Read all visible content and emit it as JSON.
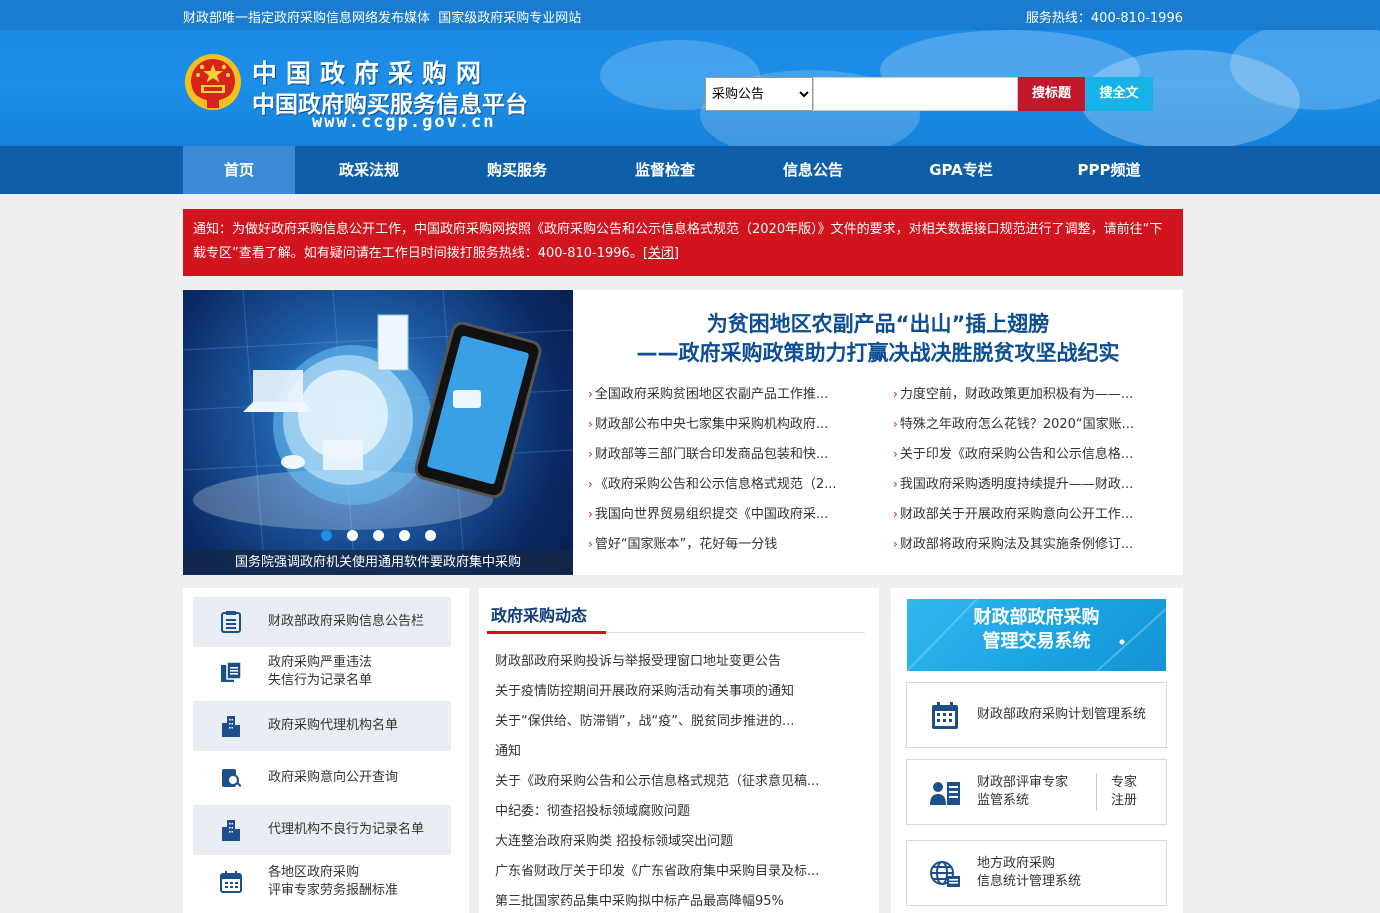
{
  "topbar": {
    "left": "财政部唯一指定政府采购信息网络发布媒体  国家级政府采购专业网站",
    "right": "服务热线：400-810-1996"
  },
  "logo": {
    "line1": "中国政府采购网",
    "line2": "中国政府购买服务信息平台",
    "url": "www.ccgp.gov.cn"
  },
  "search": {
    "select_value": "采购公告",
    "title_button": "搜标题",
    "fulltext_button": "搜全文"
  },
  "nav": [
    "首页",
    "政采法规",
    "购买服务",
    "监督检查",
    "信息公告",
    "GPA专栏",
    "PPP频道"
  ],
  "notice": {
    "text": "通知：为做好政府采购信息公开工作，中国政府采购网按照《政府采购公告和公示信息格式规范（2020年版）》文件的要求，对相关数据接口规范进行了调整，请前往“下载专区”查看了解。如有疑问请在工作日时间拨打服务热线：400-810-1996。",
    "close": "[关闭]"
  },
  "slider": {
    "caption": "国务院强调政府机关使用通用软件要政府集中采购"
  },
  "featured": {
    "title_line1": "为贫困地区农副产品“出山”插上翅膀",
    "title_line2": "——政府采购政策助力打赢决战决胜脱贫攻坚战纪实",
    "left_items": [
      "全国政府采购贫困地区农副产品工作推...",
      "财政部公布中央七家集中采购机构政府...",
      "财政部等三部门联合印发商品包装和快...",
      "《政府采购公告和公示信息格式规范（2...",
      "我国向世界贸易组织提交《中国政府采...",
      "管好“国家账本”，花好每一分钱"
    ],
    "right_items": [
      "力度空前，财政政策更加积极有为——...",
      "特殊之年政府怎么花钱？2020“国家账...",
      "关于印发《政府采购公告和公示信息格...",
      "我国政府采购透明度持续提升——财政...",
      "财政部关于开展政府采购意向公开工作...",
      "财政部将政府采购法及其实施条例修订..."
    ]
  },
  "left_links": [
    {
      "label": "财政部政府采购信息公告栏",
      "icon": "list-icon"
    },
    {
      "label": "政府采购严重违法\n失信行为记录名单",
      "icon": "documents-icon"
    },
    {
      "label": "政府采购代理机构名单",
      "icon": "building-icon"
    },
    {
      "label": "政府采购意向公开查询",
      "icon": "search-doc-icon"
    },
    {
      "label": "代理机构不良行为记录名单",
      "icon": "building-icon"
    },
    {
      "label": "各地区政府采购\n评审专家劳务报酬标准",
      "icon": "calendar-icon"
    }
  ],
  "news": {
    "heading": "政府采购动态",
    "items": [
      "财政部政府采购投诉与举报受理窗口地址变更公告",
      "关于疫情防控期间开展政府采购活动有关事项的通知",
      "关于“保供给、防滞销”，战“疫”、脱贫同步推进的...",
      "通知",
      "关于《政府采购公告和公示信息格式规范（征求意见稿...",
      "中纪委：彻查招投标领域腐败问题",
      "大连整治政府采购类 招投标领域突出问题",
      "广东省财政厅关于印发《广东省政府集中采购目录及标...",
      "第三批国家药品集中采购拟中标产品最高降幅95%"
    ]
  },
  "right": {
    "banner_line1": "财政部政府采购",
    "banner_line2": "管理交易系统",
    "box1": "财政部政府采购计划管理系统",
    "box2_left": "财政部评审专家\n监管系统",
    "box2_right": "专家\n注册",
    "box3": "地方政府采购\n信息统计管理系统"
  }
}
